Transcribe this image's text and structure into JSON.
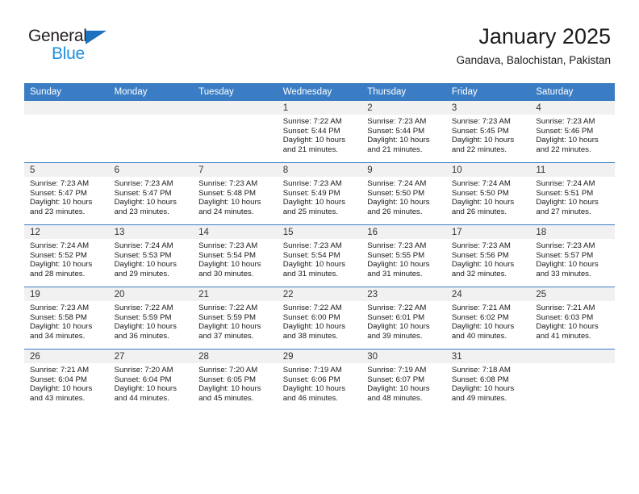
{
  "brand": {
    "name_top": "General",
    "name_bottom": "Blue",
    "accent_color": "#1f8fdf",
    "triangle_color": "#1f72bd"
  },
  "header": {
    "month_title": "January 2025",
    "location": "Gandava, Balochistan, Pakistan"
  },
  "theme": {
    "header_row_bg": "#3b7dc4",
    "daynum_band_bg": "#f1f1f1",
    "row_divider": "#3b7dc4"
  },
  "weekday_headers": [
    "Sunday",
    "Monday",
    "Tuesday",
    "Wednesday",
    "Thursday",
    "Friday",
    "Saturday"
  ],
  "weeks": [
    [
      {
        "day": "",
        "empty": true
      },
      {
        "day": "",
        "empty": true
      },
      {
        "day": "",
        "empty": true
      },
      {
        "day": "1",
        "sunrise": "Sunrise: 7:22 AM",
        "sunset": "Sunset: 5:44 PM",
        "daylight_1": "Daylight: 10 hours",
        "daylight_2": "and 21 minutes."
      },
      {
        "day": "2",
        "sunrise": "Sunrise: 7:23 AM",
        "sunset": "Sunset: 5:44 PM",
        "daylight_1": "Daylight: 10 hours",
        "daylight_2": "and 21 minutes."
      },
      {
        "day": "3",
        "sunrise": "Sunrise: 7:23 AM",
        "sunset": "Sunset: 5:45 PM",
        "daylight_1": "Daylight: 10 hours",
        "daylight_2": "and 22 minutes."
      },
      {
        "day": "4",
        "sunrise": "Sunrise: 7:23 AM",
        "sunset": "Sunset: 5:46 PM",
        "daylight_1": "Daylight: 10 hours",
        "daylight_2": "and 22 minutes."
      }
    ],
    [
      {
        "day": "5",
        "sunrise": "Sunrise: 7:23 AM",
        "sunset": "Sunset: 5:47 PM",
        "daylight_1": "Daylight: 10 hours",
        "daylight_2": "and 23 minutes."
      },
      {
        "day": "6",
        "sunrise": "Sunrise: 7:23 AM",
        "sunset": "Sunset: 5:47 PM",
        "daylight_1": "Daylight: 10 hours",
        "daylight_2": "and 23 minutes."
      },
      {
        "day": "7",
        "sunrise": "Sunrise: 7:23 AM",
        "sunset": "Sunset: 5:48 PM",
        "daylight_1": "Daylight: 10 hours",
        "daylight_2": "and 24 minutes."
      },
      {
        "day": "8",
        "sunrise": "Sunrise: 7:23 AM",
        "sunset": "Sunset: 5:49 PM",
        "daylight_1": "Daylight: 10 hours",
        "daylight_2": "and 25 minutes."
      },
      {
        "day": "9",
        "sunrise": "Sunrise: 7:24 AM",
        "sunset": "Sunset: 5:50 PM",
        "daylight_1": "Daylight: 10 hours",
        "daylight_2": "and 26 minutes."
      },
      {
        "day": "10",
        "sunrise": "Sunrise: 7:24 AM",
        "sunset": "Sunset: 5:50 PM",
        "daylight_1": "Daylight: 10 hours",
        "daylight_2": "and 26 minutes."
      },
      {
        "day": "11",
        "sunrise": "Sunrise: 7:24 AM",
        "sunset": "Sunset: 5:51 PM",
        "daylight_1": "Daylight: 10 hours",
        "daylight_2": "and 27 minutes."
      }
    ],
    [
      {
        "day": "12",
        "sunrise": "Sunrise: 7:24 AM",
        "sunset": "Sunset: 5:52 PM",
        "daylight_1": "Daylight: 10 hours",
        "daylight_2": "and 28 minutes."
      },
      {
        "day": "13",
        "sunrise": "Sunrise: 7:24 AM",
        "sunset": "Sunset: 5:53 PM",
        "daylight_1": "Daylight: 10 hours",
        "daylight_2": "and 29 minutes."
      },
      {
        "day": "14",
        "sunrise": "Sunrise: 7:23 AM",
        "sunset": "Sunset: 5:54 PM",
        "daylight_1": "Daylight: 10 hours",
        "daylight_2": "and 30 minutes."
      },
      {
        "day": "15",
        "sunrise": "Sunrise: 7:23 AM",
        "sunset": "Sunset: 5:54 PM",
        "daylight_1": "Daylight: 10 hours",
        "daylight_2": "and 31 minutes."
      },
      {
        "day": "16",
        "sunrise": "Sunrise: 7:23 AM",
        "sunset": "Sunset: 5:55 PM",
        "daylight_1": "Daylight: 10 hours",
        "daylight_2": "and 31 minutes."
      },
      {
        "day": "17",
        "sunrise": "Sunrise: 7:23 AM",
        "sunset": "Sunset: 5:56 PM",
        "daylight_1": "Daylight: 10 hours",
        "daylight_2": "and 32 minutes."
      },
      {
        "day": "18",
        "sunrise": "Sunrise: 7:23 AM",
        "sunset": "Sunset: 5:57 PM",
        "daylight_1": "Daylight: 10 hours",
        "daylight_2": "and 33 minutes."
      }
    ],
    [
      {
        "day": "19",
        "sunrise": "Sunrise: 7:23 AM",
        "sunset": "Sunset: 5:58 PM",
        "daylight_1": "Daylight: 10 hours",
        "daylight_2": "and 34 minutes."
      },
      {
        "day": "20",
        "sunrise": "Sunrise: 7:22 AM",
        "sunset": "Sunset: 5:59 PM",
        "daylight_1": "Daylight: 10 hours",
        "daylight_2": "and 36 minutes."
      },
      {
        "day": "21",
        "sunrise": "Sunrise: 7:22 AM",
        "sunset": "Sunset: 5:59 PM",
        "daylight_1": "Daylight: 10 hours",
        "daylight_2": "and 37 minutes."
      },
      {
        "day": "22",
        "sunrise": "Sunrise: 7:22 AM",
        "sunset": "Sunset: 6:00 PM",
        "daylight_1": "Daylight: 10 hours",
        "daylight_2": "and 38 minutes."
      },
      {
        "day": "23",
        "sunrise": "Sunrise: 7:22 AM",
        "sunset": "Sunset: 6:01 PM",
        "daylight_1": "Daylight: 10 hours",
        "daylight_2": "and 39 minutes."
      },
      {
        "day": "24",
        "sunrise": "Sunrise: 7:21 AM",
        "sunset": "Sunset: 6:02 PM",
        "daylight_1": "Daylight: 10 hours",
        "daylight_2": "and 40 minutes."
      },
      {
        "day": "25",
        "sunrise": "Sunrise: 7:21 AM",
        "sunset": "Sunset: 6:03 PM",
        "daylight_1": "Daylight: 10 hours",
        "daylight_2": "and 41 minutes."
      }
    ],
    [
      {
        "day": "26",
        "sunrise": "Sunrise: 7:21 AM",
        "sunset": "Sunset: 6:04 PM",
        "daylight_1": "Daylight: 10 hours",
        "daylight_2": "and 43 minutes."
      },
      {
        "day": "27",
        "sunrise": "Sunrise: 7:20 AM",
        "sunset": "Sunset: 6:04 PM",
        "daylight_1": "Daylight: 10 hours",
        "daylight_2": "and 44 minutes."
      },
      {
        "day": "28",
        "sunrise": "Sunrise: 7:20 AM",
        "sunset": "Sunset: 6:05 PM",
        "daylight_1": "Daylight: 10 hours",
        "daylight_2": "and 45 minutes."
      },
      {
        "day": "29",
        "sunrise": "Sunrise: 7:19 AM",
        "sunset": "Sunset: 6:06 PM",
        "daylight_1": "Daylight: 10 hours",
        "daylight_2": "and 46 minutes."
      },
      {
        "day": "30",
        "sunrise": "Sunrise: 7:19 AM",
        "sunset": "Sunset: 6:07 PM",
        "daylight_1": "Daylight: 10 hours",
        "daylight_2": "and 48 minutes."
      },
      {
        "day": "31",
        "sunrise": "Sunrise: 7:18 AM",
        "sunset": "Sunset: 6:08 PM",
        "daylight_1": "Daylight: 10 hours",
        "daylight_2": "and 49 minutes."
      },
      {
        "day": "",
        "empty": true
      }
    ]
  ]
}
